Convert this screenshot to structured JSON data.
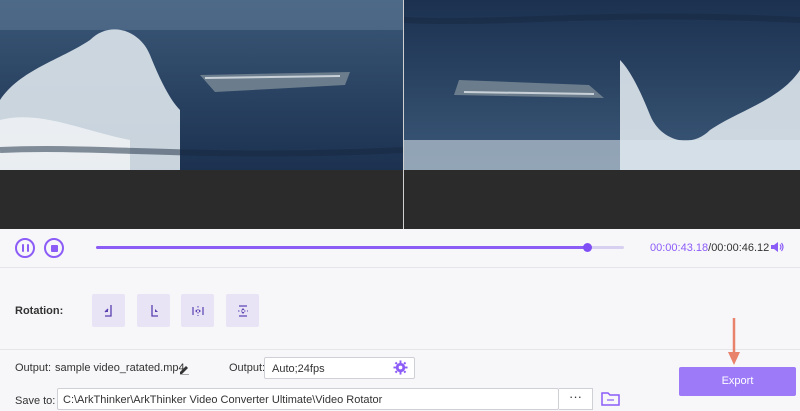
{
  "player": {
    "progress_fraction": 0.93,
    "current_time": "00:00:43.18",
    "separator": "/",
    "total_time": "00:00:46.12"
  },
  "rotation": {
    "label": "Rotation:",
    "buttons": [
      "rotate-left-icon",
      "rotate-right-icon",
      "flip-horizontal-icon",
      "flip-vertical-icon"
    ]
  },
  "output": {
    "label": "Output:",
    "filename": "sample video_ratated.mp4",
    "format_label": "Output:",
    "format_value": "Auto;24fps"
  },
  "save": {
    "label": "Save to:",
    "path": "C:\\ArkThinker\\ArkThinker Video Converter Ultimate\\Video Rotator",
    "browse_label": "···"
  },
  "export": {
    "label": "Export"
  },
  "colors": {
    "accent": "#8c5cf7",
    "export_bg": "#9d7af8",
    "annotation_arrow": "#e9826b"
  }
}
